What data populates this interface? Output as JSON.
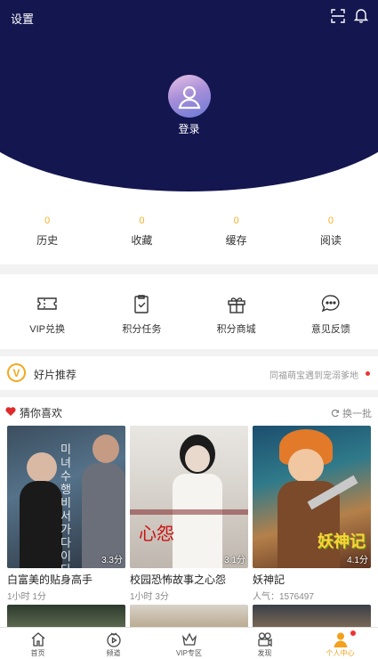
{
  "header": {
    "settings_label": "设置",
    "login_label": "登录"
  },
  "stats": [
    {
      "count": "0",
      "label": "历史"
    },
    {
      "count": "0",
      "label": "收藏"
    },
    {
      "count": "0",
      "label": "缓存"
    },
    {
      "count": "0",
      "label": "阅读"
    }
  ],
  "tools": [
    {
      "label": "VIP兑换",
      "icon": "ticket-icon"
    },
    {
      "label": "积分任务",
      "icon": "task-clipboard-icon"
    },
    {
      "label": "积分商城",
      "icon": "gift-icon"
    },
    {
      "label": "意见反馈",
      "icon": "feedback-chat-icon"
    }
  ],
  "recommend": {
    "badge": "V",
    "title": "好片推荐",
    "news": "同福萌宝遇到宠溺爹地"
  },
  "guess": {
    "title": "猜你喜欢",
    "refresh_label": "换一批",
    "items": [
      {
        "title": "白富美的贴身高手",
        "sub": "1小时 1分",
        "duration": "3.3分"
      },
      {
        "title": "校园恐怖故事之心怨",
        "sub": "1小时 3分",
        "duration": "3.1分"
      },
      {
        "title": "妖神記",
        "sub": "人气：1576497",
        "duration": "4.1分"
      }
    ],
    "poster_text": {
      "p1": "미녀수행비서가다이다",
      "p2": "心怨",
      "p3": "妖神记"
    }
  },
  "tabbar": [
    {
      "label": "首页",
      "icon": "home-icon"
    },
    {
      "label": "频道",
      "icon": "channel-tv-icon"
    },
    {
      "label": "VIP专区",
      "icon": "crown-icon"
    },
    {
      "label": "发现",
      "icon": "camera-icon"
    },
    {
      "label": "个人中心",
      "icon": "user-icon",
      "active": true
    }
  ],
  "colors": {
    "navy": "#141650",
    "accent": "#f4a01c",
    "dot": "#e33333"
  }
}
